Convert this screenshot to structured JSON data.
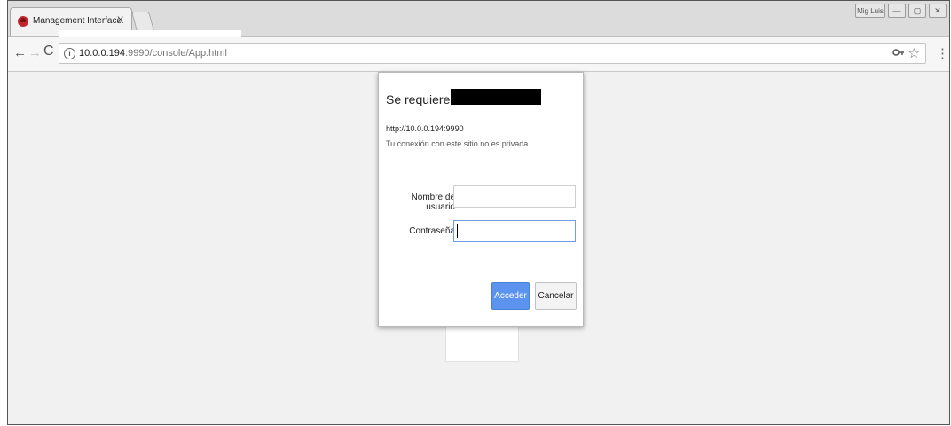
{
  "tab": {
    "title": "Management Interface",
    "close": "X",
    "favicon": "red-hat-shadowman-icon"
  },
  "window": {
    "user_label": "Mig Luis",
    "minimize": "—",
    "maximize": "▢",
    "close": "✕"
  },
  "toolbar": {
    "back": "←",
    "forward": "→",
    "reload": "C",
    "url_host": "10.0.0.194",
    "url_path": ":9990/console/App.html",
    "info": "i",
    "key": "🔑",
    "star": "☆",
    "menu": "⋮"
  },
  "background": {
    "card_text": "↖"
  },
  "dialog": {
    "title": "Se requiere un",
    "url": "http://10.0.0.194:9990",
    "warning": "Tu conexión con este sitio no es privada",
    "username_label": "Nombre de usuario",
    "password_label": "Contraseña",
    "username_value": "",
    "password_value": "",
    "accept_label": "Acceder",
    "cancel_label": "Cancelar"
  },
  "colors": {
    "accept_button": "#5b93ee",
    "favicon": "#c0262c"
  }
}
